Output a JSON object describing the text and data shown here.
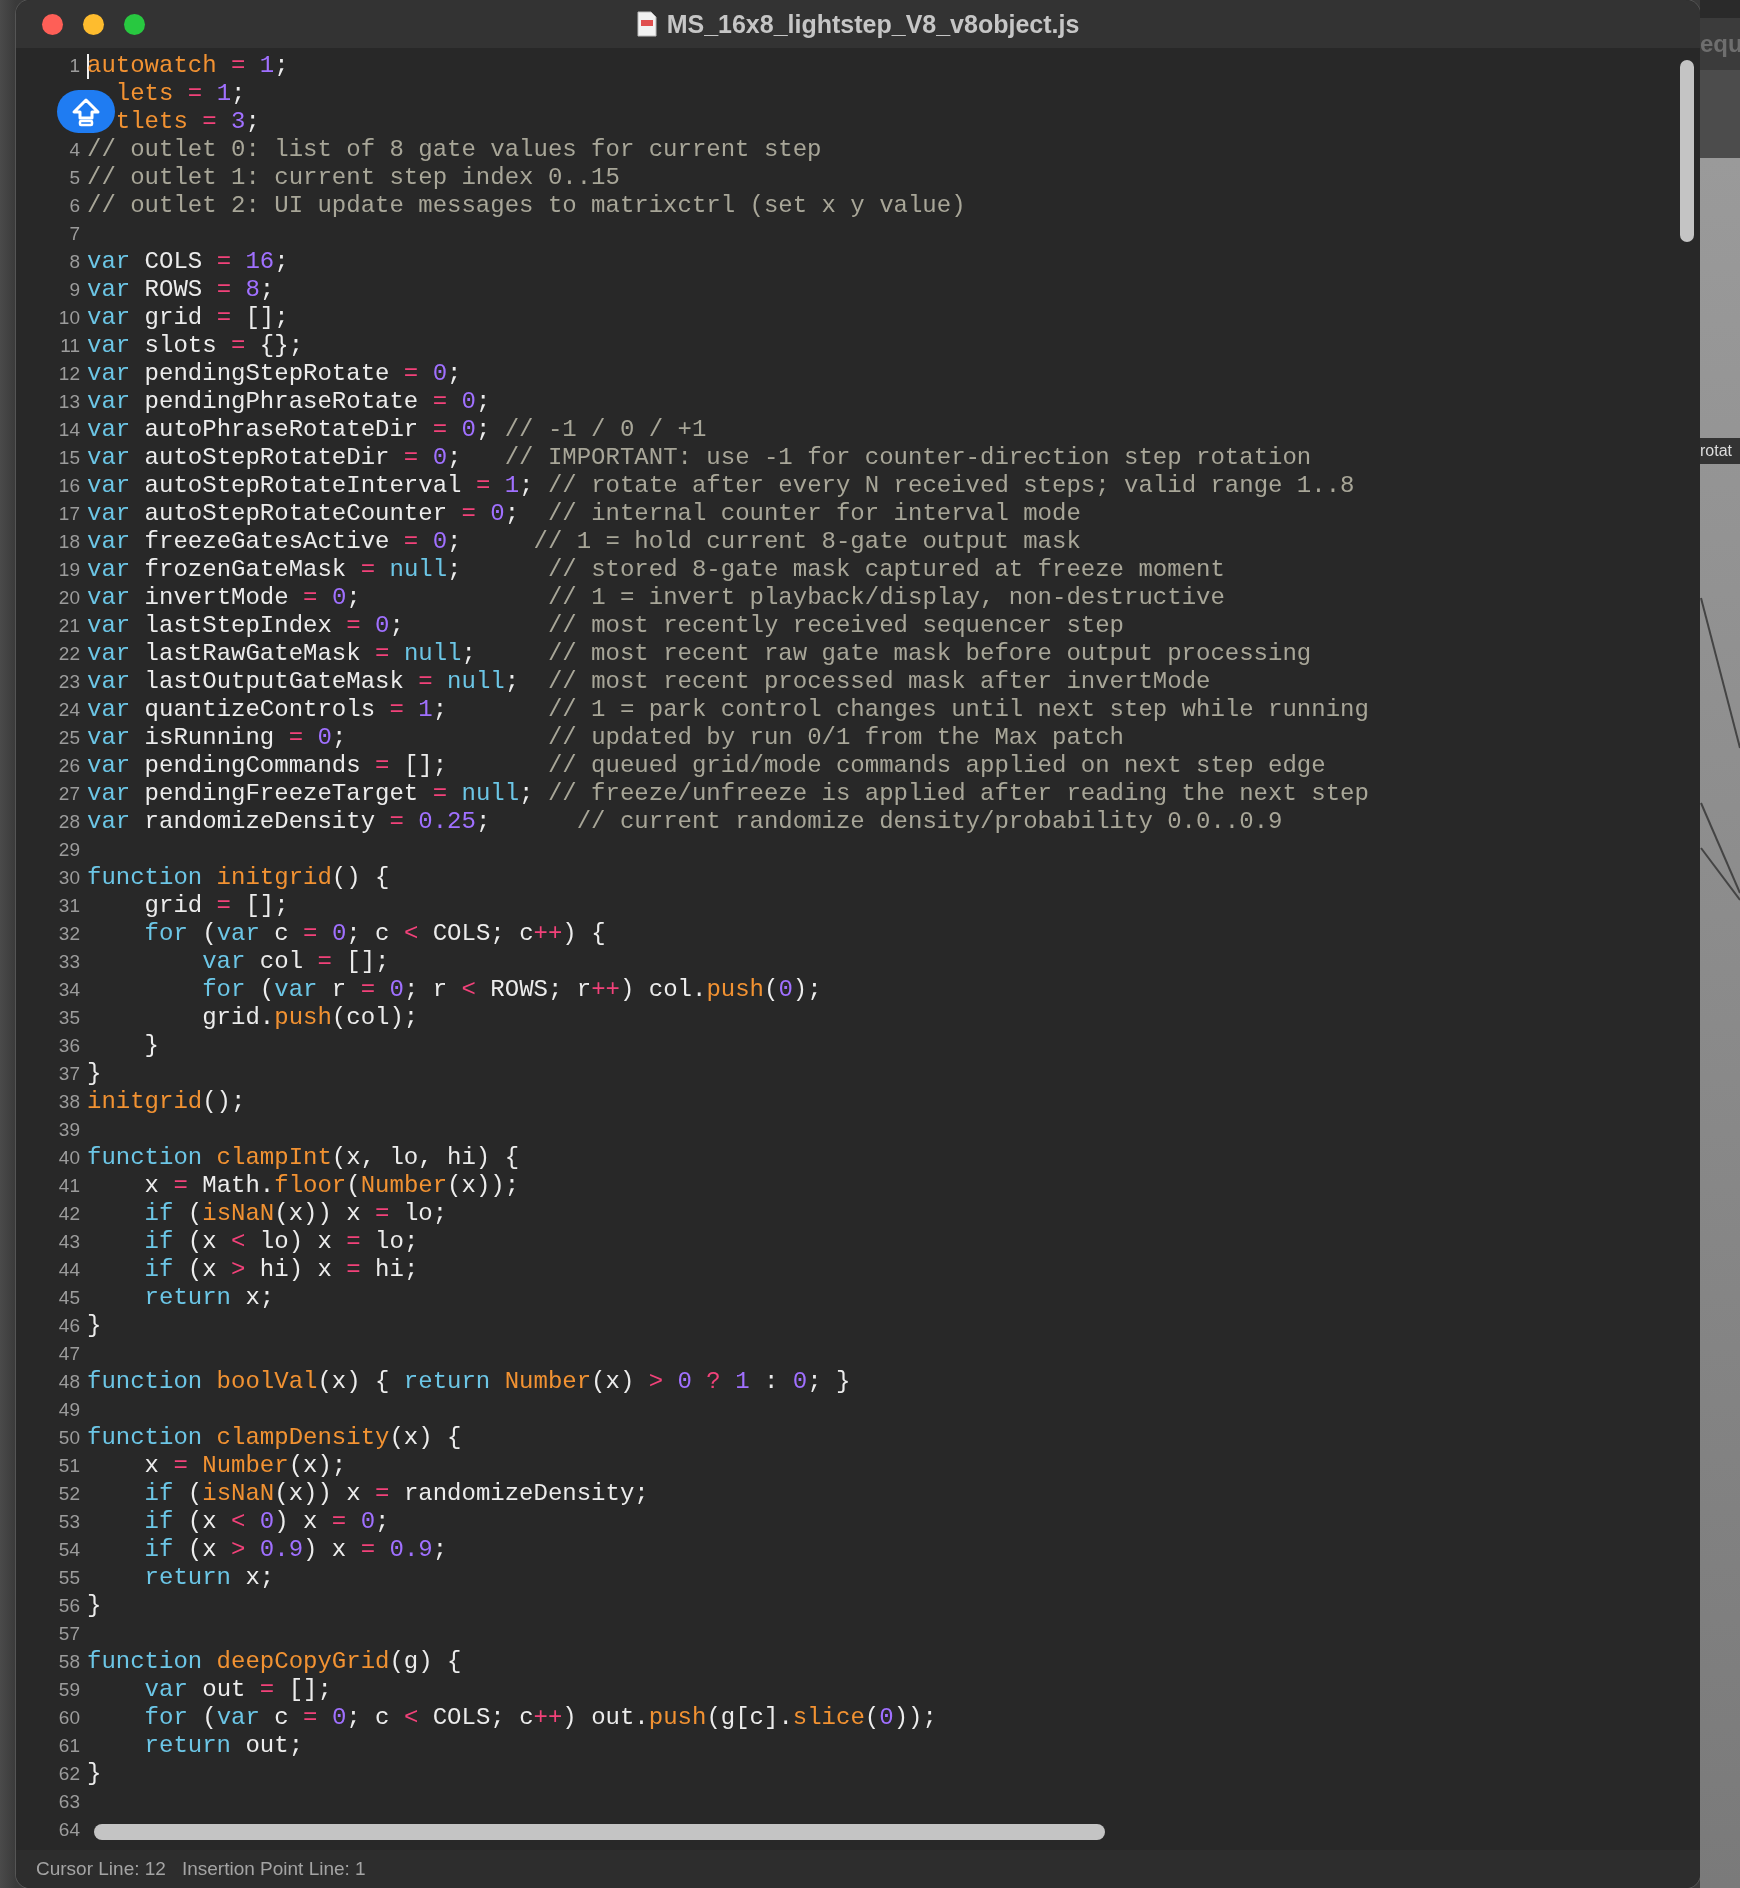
{
  "window": {
    "title": "MS_16x8_lightstep_V8_v8object.js"
  },
  "editor": {
    "lines": [
      {
        "number": "1",
        "caret": true,
        "tokens": [
          {
            "kind": "name",
            "text": "autowatch"
          },
          {
            "kind": "operator",
            "text": " = "
          },
          {
            "kind": "number",
            "text": "1"
          },
          {
            "kind": "text",
            "text": ";"
          }
        ]
      },
      {
        "caret": false,
        "tokens": [
          {
            "kind": "name",
            "text": "  lets"
          },
          {
            "kind": "operator",
            "text": " = "
          },
          {
            "kind": "number",
            "text": "1"
          },
          {
            "kind": "text",
            "text": ";"
          }
        ]
      },
      {
        "caret": false,
        "tokens": [
          {
            "kind": "name",
            "text": "  tlets"
          },
          {
            "kind": "operator",
            "text": " = "
          },
          {
            "kind": "number",
            "text": "3"
          },
          {
            "kind": "text",
            "text": ";"
          }
        ]
      },
      {
        "number": "4",
        "caret": false,
        "tokens": [
          {
            "kind": "comment",
            "text": "// outlet 0: list of 8 gate values for current step"
          }
        ]
      },
      {
        "number": "5",
        "caret": false,
        "tokens": [
          {
            "kind": "comment",
            "text": "// outlet 1: current step index 0..15"
          }
        ]
      },
      {
        "number": "6",
        "caret": false,
        "tokens": [
          {
            "kind": "comment",
            "text": "// outlet 2: UI update messages to matrixctrl (set x y value)"
          }
        ]
      },
      {
        "number": "7",
        "caret": false
      },
      {
        "number": "8",
        "caret": false,
        "tokens": [
          {
            "kind": "keyword",
            "text": "var"
          },
          {
            "kind": "text",
            "text": " COLS"
          },
          {
            "kind": "operator",
            "text": " = "
          },
          {
            "kind": "number",
            "text": "16"
          },
          {
            "kind": "text",
            "text": ";"
          }
        ]
      },
      {
        "number": "9",
        "caret": false,
        "tokens": [
          {
            "kind": "keyword",
            "text": "var"
          },
          {
            "kind": "text",
            "text": " ROWS"
          },
          {
            "kind": "operator",
            "text": " = "
          },
          {
            "kind": "number",
            "text": "8"
          },
          {
            "kind": "text",
            "text": ";"
          }
        ]
      },
      {
        "number": "10",
        "caret": false,
        "tokens": [
          {
            "kind": "keyword",
            "text": "var"
          },
          {
            "kind": "text",
            "text": " grid"
          },
          {
            "kind": "operator",
            "text": " = "
          },
          {
            "kind": "text",
            "text": "[];"
          }
        ]
      },
      {
        "number": "11",
        "caret": false,
        "tokens": [
          {
            "kind": "keyword",
            "text": "var"
          },
          {
            "kind": "text",
            "text": " slots"
          },
          {
            "kind": "operator",
            "text": " = "
          },
          {
            "kind": "text",
            "text": "{};"
          }
        ]
      },
      {
        "number": "12",
        "caret": false,
        "tokens": [
          {
            "kind": "keyword",
            "text": "var"
          },
          {
            "kind": "text",
            "text": " pendingStepRotate"
          },
          {
            "kind": "operator",
            "text": " = "
          },
          {
            "kind": "number",
            "text": "0"
          },
          {
            "kind": "text",
            "text": ";"
          }
        ]
      },
      {
        "number": "13",
        "caret": false,
        "tokens": [
          {
            "kind": "keyword",
            "text": "var"
          },
          {
            "kind": "text",
            "text": " pendingPhraseRotate"
          },
          {
            "kind": "operator",
            "text": " = "
          },
          {
            "kind": "number",
            "text": "0"
          },
          {
            "kind": "text",
            "text": ";"
          }
        ]
      },
      {
        "number": "14",
        "caret": false,
        "tokens": [
          {
            "kind": "keyword",
            "text": "var"
          },
          {
            "kind": "text",
            "text": " autoPhraseRotateDir"
          },
          {
            "kind": "operator",
            "text": " = "
          },
          {
            "kind": "number",
            "text": "0"
          },
          {
            "kind": "text",
            "text": "; "
          },
          {
            "kind": "comment",
            "text": "// -1 / 0 / +1"
          }
        ]
      },
      {
        "number": "15",
        "caret": false,
        "tokens": [
          {
            "kind": "keyword",
            "text": "var"
          },
          {
            "kind": "text",
            "text": " autoStepRotateDir"
          },
          {
            "kind": "operator",
            "text": " = "
          },
          {
            "kind": "number",
            "text": "0"
          },
          {
            "kind": "text",
            "text": ";   "
          },
          {
            "kind": "comment",
            "text": "// IMPORTANT: use -1 for counter-direction step rotation"
          }
        ]
      },
      {
        "number": "16",
        "caret": false,
        "tokens": [
          {
            "kind": "keyword",
            "text": "var"
          },
          {
            "kind": "text",
            "text": " autoStepRotateInterval"
          },
          {
            "kind": "operator",
            "text": " = "
          },
          {
            "kind": "number",
            "text": "1"
          },
          {
            "kind": "text",
            "text": "; "
          },
          {
            "kind": "comment",
            "text": "// rotate after every N received steps; valid range 1..8"
          }
        ]
      },
      {
        "number": "17",
        "caret": false,
        "tokens": [
          {
            "kind": "keyword",
            "text": "var"
          },
          {
            "kind": "text",
            "text": " autoStepRotateCounter"
          },
          {
            "kind": "operator",
            "text": " = "
          },
          {
            "kind": "number",
            "text": "0"
          },
          {
            "kind": "text",
            "text": ";  "
          },
          {
            "kind": "comment",
            "text": "// internal counter for interval mode"
          }
        ]
      },
      {
        "number": "18",
        "caret": false,
        "tokens": [
          {
            "kind": "keyword",
            "text": "var"
          },
          {
            "kind": "text",
            "text": " freezeGatesActive"
          },
          {
            "kind": "operator",
            "text": " = "
          },
          {
            "kind": "number",
            "text": "0"
          },
          {
            "kind": "text",
            "text": ";     "
          },
          {
            "kind": "comment",
            "text": "// 1 = hold current 8-gate output mask"
          }
        ]
      },
      {
        "number": "19",
        "caret": false,
        "tokens": [
          {
            "kind": "keyword",
            "text": "var"
          },
          {
            "kind": "text",
            "text": " frozenGateMask"
          },
          {
            "kind": "operator",
            "text": " = "
          },
          {
            "kind": "keyword",
            "text": "null"
          },
          {
            "kind": "text",
            "text": ";      "
          },
          {
            "kind": "comment",
            "text": "// stored 8-gate mask captured at freeze moment"
          }
        ]
      },
      {
        "number": "20",
        "caret": false,
        "tokens": [
          {
            "kind": "keyword",
            "text": "var"
          },
          {
            "kind": "text",
            "text": " invertMode"
          },
          {
            "kind": "operator",
            "text": " = "
          },
          {
            "kind": "number",
            "text": "0"
          },
          {
            "kind": "text",
            "text": ";             "
          },
          {
            "kind": "comment",
            "text": "// 1 = invert playback/display, non-destructive"
          }
        ]
      },
      {
        "number": "21",
        "caret": false,
        "tokens": [
          {
            "kind": "keyword",
            "text": "var"
          },
          {
            "kind": "text",
            "text": " lastStepIndex"
          },
          {
            "kind": "operator",
            "text": " = "
          },
          {
            "kind": "number",
            "text": "0"
          },
          {
            "kind": "text",
            "text": ";          "
          },
          {
            "kind": "comment",
            "text": "// most recently received sequencer step"
          }
        ]
      },
      {
        "number": "22",
        "caret": false,
        "tokens": [
          {
            "kind": "keyword",
            "text": "var"
          },
          {
            "kind": "text",
            "text": " lastRawGateMask"
          },
          {
            "kind": "operator",
            "text": " = "
          },
          {
            "kind": "keyword",
            "text": "null"
          },
          {
            "kind": "text",
            "text": ";     "
          },
          {
            "kind": "comment",
            "text": "// most recent raw gate mask before output processing"
          }
        ]
      },
      {
        "number": "23",
        "caret": false,
        "tokens": [
          {
            "kind": "keyword",
            "text": "var"
          },
          {
            "kind": "text",
            "text": " lastOutputGateMask"
          },
          {
            "kind": "operator",
            "text": " = "
          },
          {
            "kind": "keyword",
            "text": "null"
          },
          {
            "kind": "text",
            "text": ";  "
          },
          {
            "kind": "comment",
            "text": "// most recent processed mask after invertMode"
          }
        ]
      },
      {
        "number": "24",
        "caret": false,
        "tokens": [
          {
            "kind": "keyword",
            "text": "var"
          },
          {
            "kind": "text",
            "text": " quantizeControls"
          },
          {
            "kind": "operator",
            "text": " = "
          },
          {
            "kind": "number",
            "text": "1"
          },
          {
            "kind": "text",
            "text": ";       "
          },
          {
            "kind": "comment",
            "text": "// 1 = park control changes until next step while running"
          }
        ]
      },
      {
        "number": "25",
        "caret": false,
        "tokens": [
          {
            "kind": "keyword",
            "text": "var"
          },
          {
            "kind": "text",
            "text": " isRunning"
          },
          {
            "kind": "operator",
            "text": " = "
          },
          {
            "kind": "number",
            "text": "0"
          },
          {
            "kind": "text",
            "text": ";              "
          },
          {
            "kind": "comment",
            "text": "// updated by run 0/1 from the Max patch"
          }
        ]
      },
      {
        "number": "26",
        "caret": false,
        "tokens": [
          {
            "kind": "keyword",
            "text": "var"
          },
          {
            "kind": "text",
            "text": " pendingCommands"
          },
          {
            "kind": "operator",
            "text": " = "
          },
          {
            "kind": "text",
            "text": "[];       "
          },
          {
            "kind": "comment",
            "text": "// queued grid/mode commands applied on next step edge"
          }
        ]
      },
      {
        "number": "27",
        "caret": false,
        "tokens": [
          {
            "kind": "keyword",
            "text": "var"
          },
          {
            "kind": "text",
            "text": " pendingFreezeTarget"
          },
          {
            "kind": "operator",
            "text": " = "
          },
          {
            "kind": "keyword",
            "text": "null"
          },
          {
            "kind": "text",
            "text": "; "
          },
          {
            "kind": "comment",
            "text": "// freeze/unfreeze is applied after reading the next step"
          }
        ]
      },
      {
        "number": "28",
        "caret": false,
        "tokens": [
          {
            "kind": "keyword",
            "text": "var"
          },
          {
            "kind": "text",
            "text": " randomizeDensity"
          },
          {
            "kind": "operator",
            "text": " = "
          },
          {
            "kind": "number",
            "text": "0.25"
          },
          {
            "kind": "text",
            "text": ";      "
          },
          {
            "kind": "comment",
            "text": "// current randomize density/probability 0.0..0.9"
          }
        ]
      },
      {
        "number": "29",
        "caret": false
      },
      {
        "number": "30",
        "caret": false,
        "tokens": [
          {
            "kind": "keyword",
            "text": "function"
          },
          {
            "kind": "name",
            "text": " initgrid"
          },
          {
            "kind": "text",
            "text": "() {"
          }
        ]
      },
      {
        "number": "31",
        "caret": false,
        "tokens": [
          {
            "kind": "text",
            "text": "    grid"
          },
          {
            "kind": "operator",
            "text": " = "
          },
          {
            "kind": "text",
            "text": "[];"
          }
        ]
      },
      {
        "number": "32",
        "caret": false,
        "tokens": [
          {
            "kind": "keyword",
            "text": "    for"
          },
          {
            "kind": "text",
            "text": " ("
          },
          {
            "kind": "keyword",
            "text": "var"
          },
          {
            "kind": "text",
            "text": " c"
          },
          {
            "kind": "operator",
            "text": " = "
          },
          {
            "kind": "number",
            "text": "0"
          },
          {
            "kind": "text",
            "text": "; c "
          },
          {
            "kind": "operator",
            "text": "<"
          },
          {
            "kind": "text",
            "text": " COLS; c"
          },
          {
            "kind": "operator",
            "text": "++"
          },
          {
            "kind": "text",
            "text": ") {"
          }
        ]
      },
      {
        "number": "33",
        "caret": false,
        "tokens": [
          {
            "kind": "keyword",
            "text": "        var"
          },
          {
            "kind": "text",
            "text": " col"
          },
          {
            "kind": "operator",
            "text": " = "
          },
          {
            "kind": "text",
            "text": "[];"
          }
        ]
      },
      {
        "number": "34",
        "caret": false,
        "tokens": [
          {
            "kind": "keyword",
            "text": "        for"
          },
          {
            "kind": "text",
            "text": " ("
          },
          {
            "kind": "keyword",
            "text": "var"
          },
          {
            "kind": "text",
            "text": " r"
          },
          {
            "kind": "operator",
            "text": " = "
          },
          {
            "kind": "number",
            "text": "0"
          },
          {
            "kind": "text",
            "text": "; r "
          },
          {
            "kind": "operator",
            "text": "<"
          },
          {
            "kind": "text",
            "text": " ROWS; r"
          },
          {
            "kind": "operator",
            "text": "++"
          },
          {
            "kind": "text",
            "text": ") col."
          },
          {
            "kind": "name",
            "text": "push"
          },
          {
            "kind": "text",
            "text": "("
          },
          {
            "kind": "number",
            "text": "0"
          },
          {
            "kind": "text",
            "text": ");"
          }
        ]
      },
      {
        "number": "35",
        "caret": false,
        "tokens": [
          {
            "kind": "text",
            "text": "        grid."
          },
          {
            "kind": "name",
            "text": "push"
          },
          {
            "kind": "text",
            "text": "(col);"
          }
        ]
      },
      {
        "number": "36",
        "caret": false,
        "tokens": [
          {
            "kind": "text",
            "text": "    }"
          }
        ]
      },
      {
        "number": "37",
        "caret": false,
        "tokens": [
          {
            "kind": "text",
            "text": "}"
          }
        ]
      },
      {
        "number": "38",
        "caret": false,
        "tokens": [
          {
            "kind": "name",
            "text": "initgrid"
          },
          {
            "kind": "text",
            "text": "();"
          }
        ]
      },
      {
        "number": "39",
        "caret": false
      },
      {
        "number": "40",
        "caret": false,
        "tokens": [
          {
            "kind": "keyword",
            "text": "function"
          },
          {
            "kind": "name",
            "text": " clampInt"
          },
          {
            "kind": "text",
            "text": "(x, lo, hi) {"
          }
        ]
      },
      {
        "number": "41",
        "caret": false,
        "tokens": [
          {
            "kind": "text",
            "text": "    x"
          },
          {
            "kind": "operator",
            "text": " = "
          },
          {
            "kind": "text",
            "text": "Math."
          },
          {
            "kind": "name",
            "text": "floor"
          },
          {
            "kind": "text",
            "text": "("
          },
          {
            "kind": "name",
            "text": "Number"
          },
          {
            "kind": "text",
            "text": "(x));"
          }
        ]
      },
      {
        "number": "42",
        "caret": false,
        "tokens": [
          {
            "kind": "keyword",
            "text": "    if"
          },
          {
            "kind": "text",
            "text": " ("
          },
          {
            "kind": "name",
            "text": "isNaN"
          },
          {
            "kind": "text",
            "text": "(x)) x"
          },
          {
            "kind": "operator",
            "text": " = "
          },
          {
            "kind": "text",
            "text": "lo;"
          }
        ]
      },
      {
        "number": "43",
        "caret": false,
        "tokens": [
          {
            "kind": "keyword",
            "text": "    if"
          },
          {
            "kind": "text",
            "text": " (x "
          },
          {
            "kind": "operator",
            "text": "<"
          },
          {
            "kind": "text",
            "text": " lo) x"
          },
          {
            "kind": "operator",
            "text": " = "
          },
          {
            "kind": "text",
            "text": "lo;"
          }
        ]
      },
      {
        "number": "44",
        "caret": false,
        "tokens": [
          {
            "kind": "keyword",
            "text": "    if"
          },
          {
            "kind": "text",
            "text": " (x "
          },
          {
            "kind": "operator",
            "text": ">"
          },
          {
            "kind": "text",
            "text": " hi) x"
          },
          {
            "kind": "operator",
            "text": " = "
          },
          {
            "kind": "text",
            "text": "hi;"
          }
        ]
      },
      {
        "number": "45",
        "caret": false,
        "tokens": [
          {
            "kind": "keyword",
            "text": "    return"
          },
          {
            "kind": "text",
            "text": " x;"
          }
        ]
      },
      {
        "number": "46",
        "caret": false,
        "tokens": [
          {
            "kind": "text",
            "text": "}"
          }
        ]
      },
      {
        "number": "47",
        "caret": false
      },
      {
        "number": "48",
        "caret": false,
        "tokens": [
          {
            "kind": "keyword",
            "text": "function"
          },
          {
            "kind": "name",
            "text": " boolVal"
          },
          {
            "kind": "text",
            "text": "(x) { "
          },
          {
            "kind": "keyword",
            "text": "return"
          },
          {
            "kind": "name",
            "text": " Number"
          },
          {
            "kind": "text",
            "text": "(x) "
          },
          {
            "kind": "operator",
            "text": ">"
          },
          {
            "kind": "number",
            "text": " 0"
          },
          {
            "kind": "operator",
            "text": " ?"
          },
          {
            "kind": "number",
            "text": " 1"
          },
          {
            "kind": "text",
            "text": " : "
          },
          {
            "kind": "number",
            "text": "0"
          },
          {
            "kind": "text",
            "text": "; }"
          }
        ]
      },
      {
        "number": "49",
        "caret": false
      },
      {
        "number": "50",
        "caret": false,
        "tokens": [
          {
            "kind": "keyword",
            "text": "function"
          },
          {
            "kind": "name",
            "text": " clampDensity"
          },
          {
            "kind": "text",
            "text": "(x) {"
          }
        ]
      },
      {
        "number": "51",
        "caret": false,
        "tokens": [
          {
            "kind": "text",
            "text": "    x"
          },
          {
            "kind": "operator",
            "text": " = "
          },
          {
            "kind": "name",
            "text": "Number"
          },
          {
            "kind": "text",
            "text": "(x);"
          }
        ]
      },
      {
        "number": "52",
        "caret": false,
        "tokens": [
          {
            "kind": "keyword",
            "text": "    if"
          },
          {
            "kind": "text",
            "text": " ("
          },
          {
            "kind": "name",
            "text": "isNaN"
          },
          {
            "kind": "text",
            "text": "(x)) x"
          },
          {
            "kind": "operator",
            "text": " = "
          },
          {
            "kind": "text",
            "text": "randomizeDensity;"
          }
        ]
      },
      {
        "number": "53",
        "caret": false,
        "tokens": [
          {
            "kind": "keyword",
            "text": "    if"
          },
          {
            "kind": "text",
            "text": " (x "
          },
          {
            "kind": "operator",
            "text": "<"
          },
          {
            "kind": "number",
            "text": " 0"
          },
          {
            "kind": "text",
            "text": ") x"
          },
          {
            "kind": "operator",
            "text": " = "
          },
          {
            "kind": "number",
            "text": "0"
          },
          {
            "kind": "text",
            "text": ";"
          }
        ]
      },
      {
        "number": "54",
        "caret": false,
        "tokens": [
          {
            "kind": "keyword",
            "text": "    if"
          },
          {
            "kind": "text",
            "text": " (x "
          },
          {
            "kind": "operator",
            "text": ">"
          },
          {
            "kind": "number",
            "text": " 0.9"
          },
          {
            "kind": "text",
            "text": ") x"
          },
          {
            "kind": "operator",
            "text": " = "
          },
          {
            "kind": "number",
            "text": "0.9"
          },
          {
            "kind": "text",
            "text": ";"
          }
        ]
      },
      {
        "number": "55",
        "caret": false,
        "tokens": [
          {
            "kind": "keyword",
            "text": "    return"
          },
          {
            "kind": "text",
            "text": " x;"
          }
        ]
      },
      {
        "number": "56",
        "caret": false,
        "tokens": [
          {
            "kind": "text",
            "text": "}"
          }
        ]
      },
      {
        "number": "57",
        "caret": false
      },
      {
        "number": "58",
        "caret": false,
        "tokens": [
          {
            "kind": "keyword",
            "text": "function"
          },
          {
            "kind": "name",
            "text": " deepCopyGrid"
          },
          {
            "kind": "text",
            "text": "(g) {"
          }
        ]
      },
      {
        "number": "59",
        "caret": false,
        "tokens": [
          {
            "kind": "keyword",
            "text": "    var"
          },
          {
            "kind": "text",
            "text": " out"
          },
          {
            "kind": "operator",
            "text": " = "
          },
          {
            "kind": "text",
            "text": "[];"
          }
        ]
      },
      {
        "number": "60",
        "caret": false,
        "tokens": [
          {
            "kind": "keyword",
            "text": "    for"
          },
          {
            "kind": "text",
            "text": " ("
          },
          {
            "kind": "keyword",
            "text": "var"
          },
          {
            "kind": "text",
            "text": " c"
          },
          {
            "kind": "operator",
            "text": " = "
          },
          {
            "kind": "number",
            "text": "0"
          },
          {
            "kind": "text",
            "text": "; c "
          },
          {
            "kind": "operator",
            "text": "<"
          },
          {
            "kind": "text",
            "text": " COLS; c"
          },
          {
            "kind": "operator",
            "text": "++"
          },
          {
            "kind": "text",
            "text": ") out."
          },
          {
            "kind": "name",
            "text": "push"
          },
          {
            "kind": "text",
            "text": "(g[c]."
          },
          {
            "kind": "name",
            "text": "slice"
          },
          {
            "kind": "text",
            "text": "("
          },
          {
            "kind": "number",
            "text": "0"
          },
          {
            "kind": "text",
            "text": "));"
          }
        ]
      },
      {
        "number": "61",
        "caret": false,
        "tokens": [
          {
            "kind": "keyword",
            "text": "    return"
          },
          {
            "kind": "text",
            "text": " out;"
          }
        ]
      },
      {
        "number": "62",
        "caret": false,
        "tokens": [
          {
            "kind": "text",
            "text": "}"
          }
        ]
      },
      {
        "number": "63",
        "caret": false
      },
      {
        "number": "64",
        "caret": false
      }
    ]
  },
  "status_bar": {
    "cursor_line": "Cursor Line: 12",
    "insertion_point": "Insertion Point Line: 1"
  },
  "background_patch": {
    "title_fragment": "equ",
    "object_label": "rotat"
  }
}
